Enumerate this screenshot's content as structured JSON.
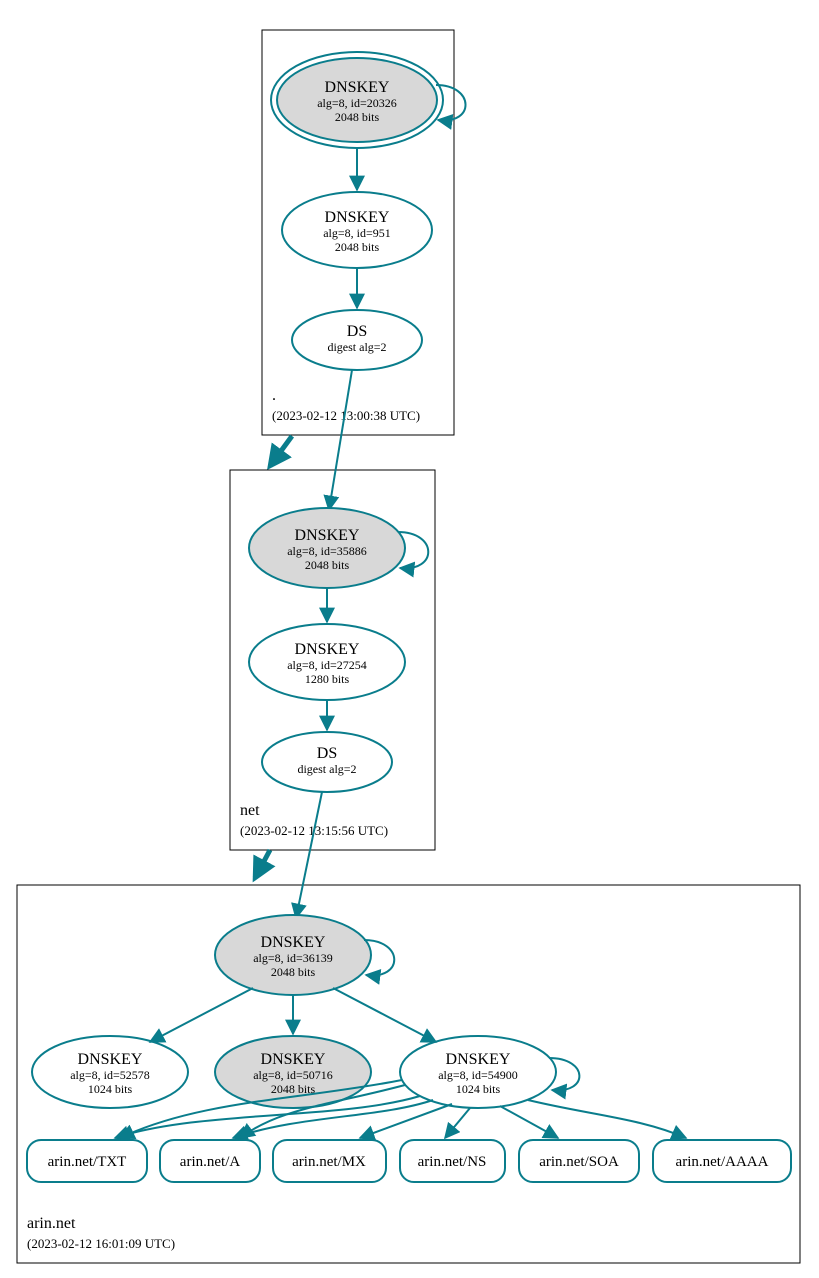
{
  "zones": {
    "root": {
      "label": ".",
      "timestamp": "(2023-02-12 13:00:38 UTC)",
      "nodes": {
        "ksk": {
          "title": "DNSKEY",
          "line2": "alg=8, id=20326",
          "line3": "2048 bits"
        },
        "zsk": {
          "title": "DNSKEY",
          "line2": "alg=8, id=951",
          "line3": "2048 bits"
        },
        "ds": {
          "title": "DS",
          "line2": "digest alg=2"
        }
      }
    },
    "net": {
      "label": "net",
      "timestamp": "(2023-02-12 13:15:56 UTC)",
      "nodes": {
        "ksk": {
          "title": "DNSKEY",
          "line2": "alg=8, id=35886",
          "line3": "2048 bits"
        },
        "zsk": {
          "title": "DNSKEY",
          "line2": "alg=8, id=27254",
          "line3": "1280 bits"
        },
        "ds": {
          "title": "DS",
          "line2": "digest alg=2"
        }
      }
    },
    "arin": {
      "label": "arin.net",
      "timestamp": "(2023-02-12 16:01:09 UTC)",
      "nodes": {
        "ksk": {
          "title": "DNSKEY",
          "line2": "alg=8, id=36139",
          "line3": "2048 bits"
        },
        "k52578": {
          "title": "DNSKEY",
          "line2": "alg=8, id=52578",
          "line3": "1024 bits"
        },
        "k50716": {
          "title": "DNSKEY",
          "line2": "alg=8, id=50716",
          "line3": "2048 bits"
        },
        "k54900": {
          "title": "DNSKEY",
          "line2": "alg=8, id=54900",
          "line3": "1024 bits"
        }
      },
      "rrsets": {
        "txt": "arin.net/TXT",
        "a": "arin.net/A",
        "mx": "arin.net/MX",
        "ns": "arin.net/NS",
        "soa": "arin.net/SOA",
        "aaaa": "arin.net/AAAA"
      }
    }
  }
}
